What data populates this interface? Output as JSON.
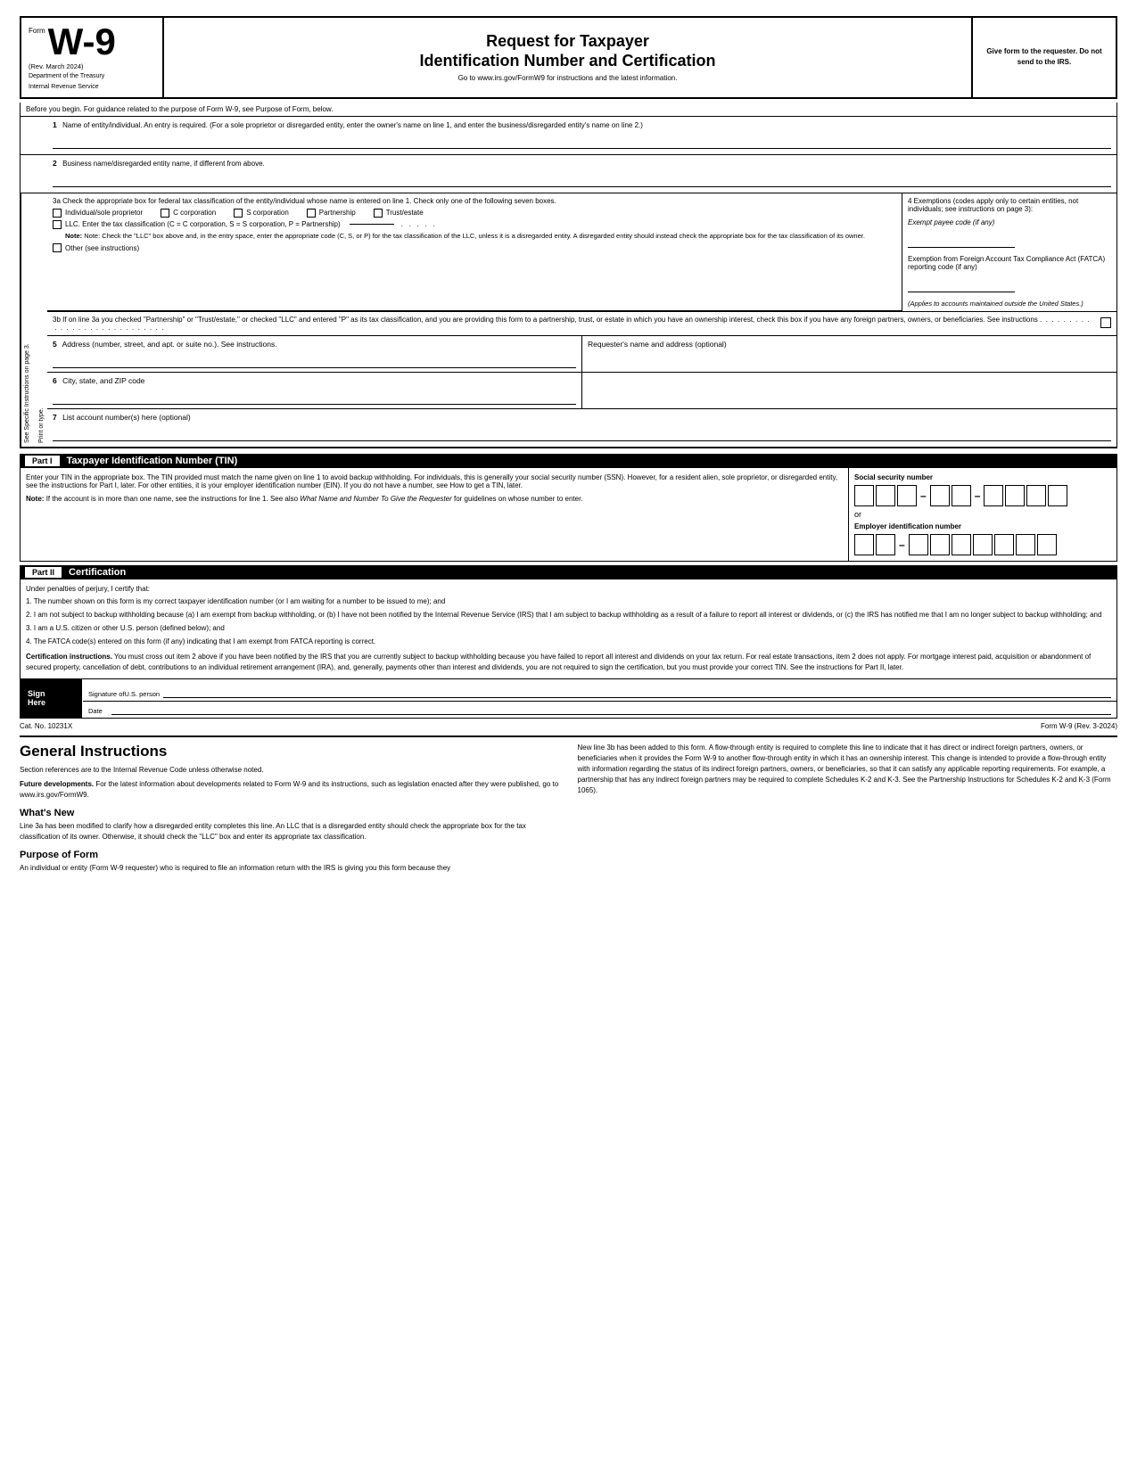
{
  "header": {
    "form_word": "Form",
    "form_number": "W-9",
    "rev_date": "(Rev. March 2024)",
    "dept_line1": "Department of the Treasury",
    "dept_line2": "Internal Revenue Service",
    "title_main": "Request for Taxpayer",
    "title_sub": "Identification Number and Certification",
    "go_to": "Go to www.irs.gov/FormW9 for instructions and the latest information.",
    "give_form": "Give form to the requester. Do not send to the IRS."
  },
  "before_begin": {
    "text": "Before you begin. For guidance related to the purpose of Form W-9, see Purpose of Form, below."
  },
  "field1": {
    "num": "1",
    "label": "Name of entity/individual. An entry is required. (For a sole proprietor or disregarded entity, enter the owner's name on line 1, and enter the business/disregarded entity's name on line 2.)"
  },
  "field2": {
    "num": "2",
    "label": "Business name/disregarded entity name, if different from above."
  },
  "field3a": {
    "label": "3a Check the appropriate box for federal tax classification of the entity/individual whose name is entered on line 1. Check only one of the following seven boxes.",
    "options": [
      "Individual/sole proprietor",
      "C corporation",
      "S corporation",
      "Partnership",
      "Trust/estate"
    ],
    "llc_label": "LLC. Enter the tax classification (C = C corporation, S = S corporation, P = Partnership)",
    "note_text": "Note: Check the \"LLC\" box above and, in the entry space, enter the appropriate code (C, S, or P) for the tax classification of the LLC, unless it is a disregarded entity. A disregarded entity should instead check the appropriate box for the tax classification of its owner.",
    "other_label": "Other (see instructions)"
  },
  "field4": {
    "label": "4 Exemptions (codes apply only to certain entities, not individuals; see instructions on page 3):",
    "exempt_payee": "Exempt payee code (if any)",
    "fatca_heading": "Exemption from Foreign Account Tax Compliance Act (FATCA) reporting code (if any)",
    "applies": "(Applies to accounts maintained outside the United States.)"
  },
  "field3b": {
    "text": "3b If on line 3a you checked \"Partnership\" or \"Trust/estate,\" or checked \"LLC\" and entered \"P\" as its tax classification, and you are providing this form to a partnership, trust, or estate in which you have an ownership interest, check this box if you have any foreign partners, owners, or beneficiaries. See instructions"
  },
  "field5": {
    "num": "5",
    "label": "Address (number, street, and apt. or suite no.). See instructions.",
    "requesters_label": "Requester's name and address (optional)"
  },
  "field6": {
    "num": "6",
    "label": "City, state, and ZIP code"
  },
  "field7": {
    "num": "7",
    "label": "List account number(s) here (optional)"
  },
  "side_label": {
    "line1": "Print or type.",
    "line2": "See Specific Instructions on page 3."
  },
  "part1": {
    "label": "Part I",
    "title": "Taxpayer Identification Number (TIN)",
    "text": "Enter your TIN in the appropriate box. The TIN provided must match the name given on line 1 to avoid backup withholding. For individuals, this is generally your social security number (SSN). However, for a resident alien, sole proprietor, or disregarded entity, see the instructions for Part I, later. For other entities, it is your employer identification number (EIN). If you do not have a number, see How to get a TIN, later.",
    "note": "Note: If the account is in more than one name, see the instructions for line 1. See also What Name and Number To Give the Requester for guidelines on whose number to enter.",
    "ssn_label": "Social security number",
    "or_label": "or",
    "ein_label": "Employer identification number"
  },
  "part2": {
    "label": "Part II",
    "title": "Certification",
    "under_penalties": "Under penalties of perjury, I certify that:",
    "items": [
      "1. The number shown on this form is my correct taxpayer identification number (or I am waiting for a number to be issued to me); and",
      "2. I am not subject to backup withholding because (a) I am exempt from backup withholding, or (b) I have not been notified by the Internal Revenue Service (IRS) that I am subject to backup withholding as a result of a failure to report all interest or dividends, or (c) the IRS has notified me that I am no longer subject to backup withholding; and",
      "3. I am a U.S. citizen or other U.S. person (defined below); and",
      "4. The FATCA code(s) entered on this form (if any) indicating that I am exempt from FATCA reporting is correct."
    ],
    "cert_instructions_bold": "Certification instructions.",
    "cert_instructions": " You must cross out item 2 above if you have been notified by the IRS that you are currently subject to backup withholding because you have failed to report all interest and dividends on your tax return. For real estate transactions, item 2 does not apply. For mortgage interest paid, acquisition or abandonment of secured property, cancellation of debt, contributions to an individual retirement arrangement (IRA), and, generally, payments other than interest and dividends, you are not required to sign the certification, but you must provide your correct TIN. See the instructions for Part II, later."
  },
  "sign_here": {
    "sign_label": "Sign\nHere",
    "sig_of": "Signature of",
    "us_person": "U.S. person",
    "date_label": "Date"
  },
  "footer": {
    "cat_no": "Cat. No. 10231X",
    "form_ref": "Form W-9 (Rev. 3-2024)"
  },
  "general_instructions": {
    "heading": "General Instructions",
    "section_refs": "Section references are to the Internal Revenue Code unless otherwise noted.",
    "future_bold": "Future developments.",
    "future_text": " For the latest information about developments related to Form W-9 and its instructions, such as legislation enacted after they were published, go to www.irs.gov/FormW9.",
    "whats_new_heading": "What's New",
    "whats_new_text": "Line 3a has been modified to clarify how a disregarded entity completes this line. An LLC that is a disregarded entity should check the appropriate box for the tax classification of its owner. Otherwise, it should check the \"LLC\" box and enter its appropriate tax classification.",
    "new_line_3b_heading": "",
    "new_line_3b_text": "New line 3b has been added to this form. A flow-through entity is required to complete this line to indicate that it has direct or indirect foreign partners, owners, or beneficiaries when it provides the Form W-9 to another flow-through entity in which it has an ownership interest. This change is intended to provide a flow-through entity with information regarding the status of its indirect foreign partners, owners, or beneficiaries, so that it can satisfy any applicable reporting requirements. For example, a partnership that has any indirect foreign partners may be required to complete Schedules K-2 and K-3. See the Partnership Instructions for Schedules K-2 and K-3 (Form 1065).",
    "purpose_heading": "Purpose of Form",
    "purpose_text": "An individual or entity (Form W-9 requester) who is required to file an information return with the IRS is giving you this form because they"
  }
}
